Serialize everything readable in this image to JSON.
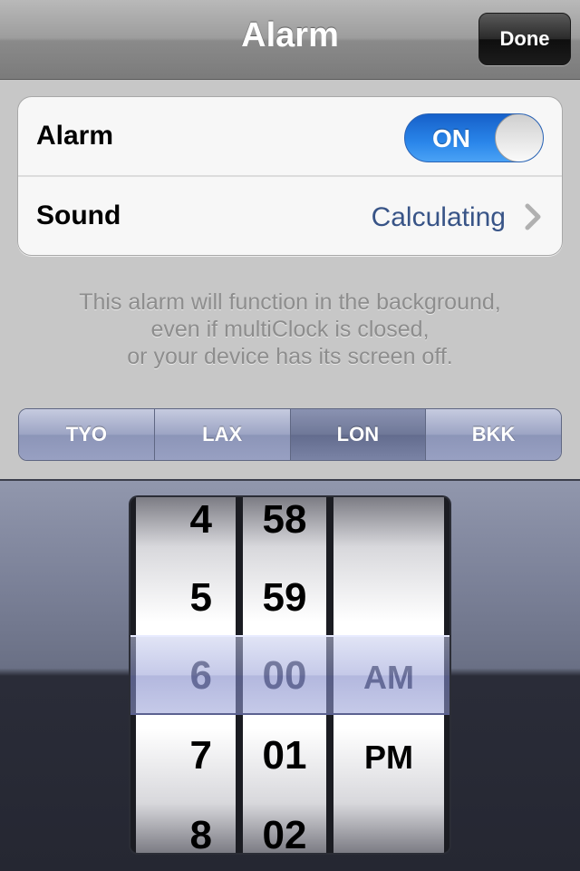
{
  "nav": {
    "title": "Alarm",
    "done_label": "Done"
  },
  "settings": {
    "alarm_label": "Alarm",
    "alarm_toggle": "ON",
    "sound_label": "Sound",
    "sound_value": "Calculating"
  },
  "info": {
    "line1": "This alarm will function in the background,",
    "line2": "even if multiClock is closed,",
    "line3": "or your device has its screen off."
  },
  "segments": [
    "TYO",
    "LAX",
    "LON",
    "BKK"
  ],
  "selected_segment": "LON",
  "picker": {
    "hours": [
      "4",
      "5",
      "6",
      "7",
      "8"
    ],
    "minutes": [
      "58",
      "59",
      "00",
      "01",
      "02"
    ],
    "ampm": [
      "AM",
      "PM"
    ],
    "selected": {
      "hour": "6",
      "minute": "00",
      "ampm": "AM"
    }
  },
  "colors": {
    "toggle_on": "#2a86ea",
    "value_text": "#385487"
  },
  "icons": {
    "chevron": "chevron-right-icon",
    "toggle_knob": "toggle-knob"
  }
}
